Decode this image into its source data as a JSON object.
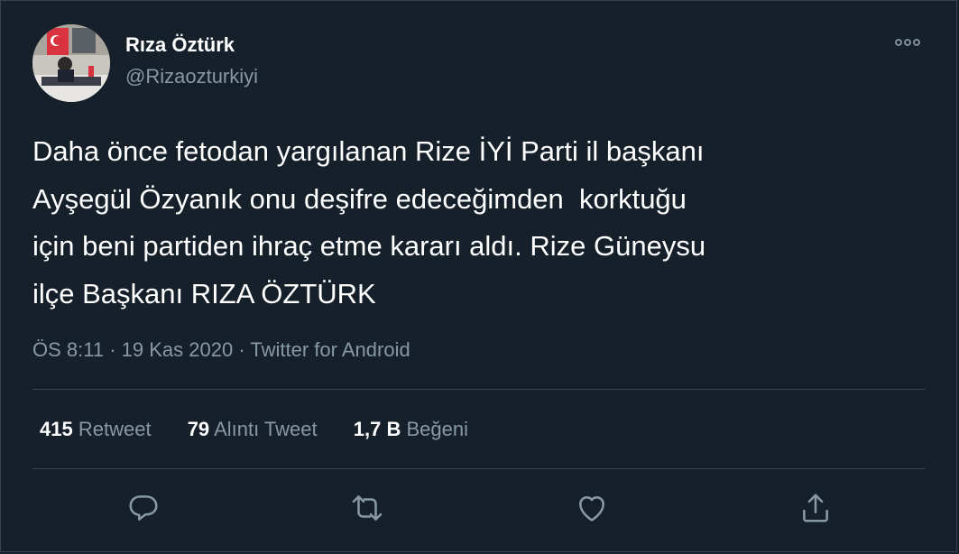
{
  "author": {
    "name": "Rıza Öztürk",
    "handle": "@Rizaozturkiyi"
  },
  "tweet": {
    "text": "Daha önce fetodan yargılanan Rize İYİ Parti il başkanı\nAyşegül Özyanık onu deşifre edeceğimden  korktuğu\niçin beni partiden ihraç etme kararı aldı. Rize Güneysu\nilçe Başkanı RIZA ÖZTÜRK",
    "time": "ÖS 8:11",
    "date": "19 Kas 2020",
    "source": "Twitter for Android",
    "separator": "·"
  },
  "stats": {
    "retweets": {
      "count": "415",
      "label": "Retweet"
    },
    "quotes": {
      "count": "79",
      "label": "Alıntı Tweet"
    },
    "likes": {
      "count": "1,7 B",
      "label": "Beğeni"
    }
  },
  "icons": {
    "more": "more-icon",
    "reply": "reply-icon",
    "retweet": "retweet-icon",
    "like": "like-icon",
    "share": "share-icon"
  },
  "colors": {
    "background": "#15202b",
    "text": "#ffffff",
    "secondary": "#8899a6",
    "border": "#38444d"
  }
}
